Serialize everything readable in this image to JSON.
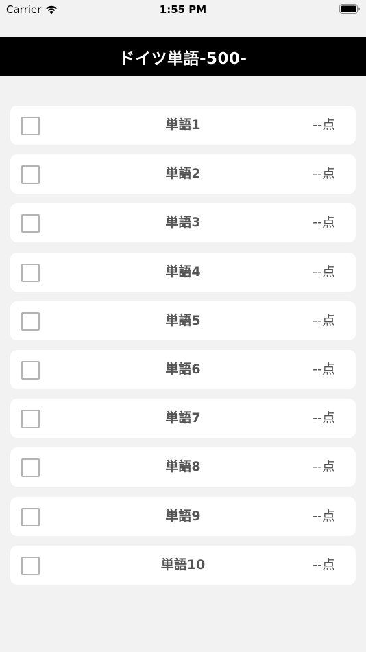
{
  "status_bar": {
    "carrier": "Carrier",
    "time": "1:55 PM",
    "wifi_icon": "wifi-icon",
    "battery_icon": "battery-icon"
  },
  "header": {
    "title": "ドイツ単語-500-"
  },
  "items": [
    {
      "label": "単語1",
      "score": "--点",
      "checked": false
    },
    {
      "label": "単語2",
      "score": "--点",
      "checked": false
    },
    {
      "label": "単語3",
      "score": "--点",
      "checked": false
    },
    {
      "label": "単語4",
      "score": "--点",
      "checked": false
    },
    {
      "label": "単語5",
      "score": "--点",
      "checked": false
    },
    {
      "label": "単語6",
      "score": "--点",
      "checked": false
    },
    {
      "label": "単語7",
      "score": "--点",
      "checked": false
    },
    {
      "label": "単語8",
      "score": "--点",
      "checked": false
    },
    {
      "label": "単語9",
      "score": "--点",
      "checked": false
    },
    {
      "label": "単語10",
      "score": "--点",
      "checked": false
    }
  ],
  "colors": {
    "header_bg": "#000000",
    "page_bg": "#f2f2f2",
    "card_bg": "#ffffff",
    "text": "#555555",
    "checkbox_border": "#b4b4b4"
  }
}
